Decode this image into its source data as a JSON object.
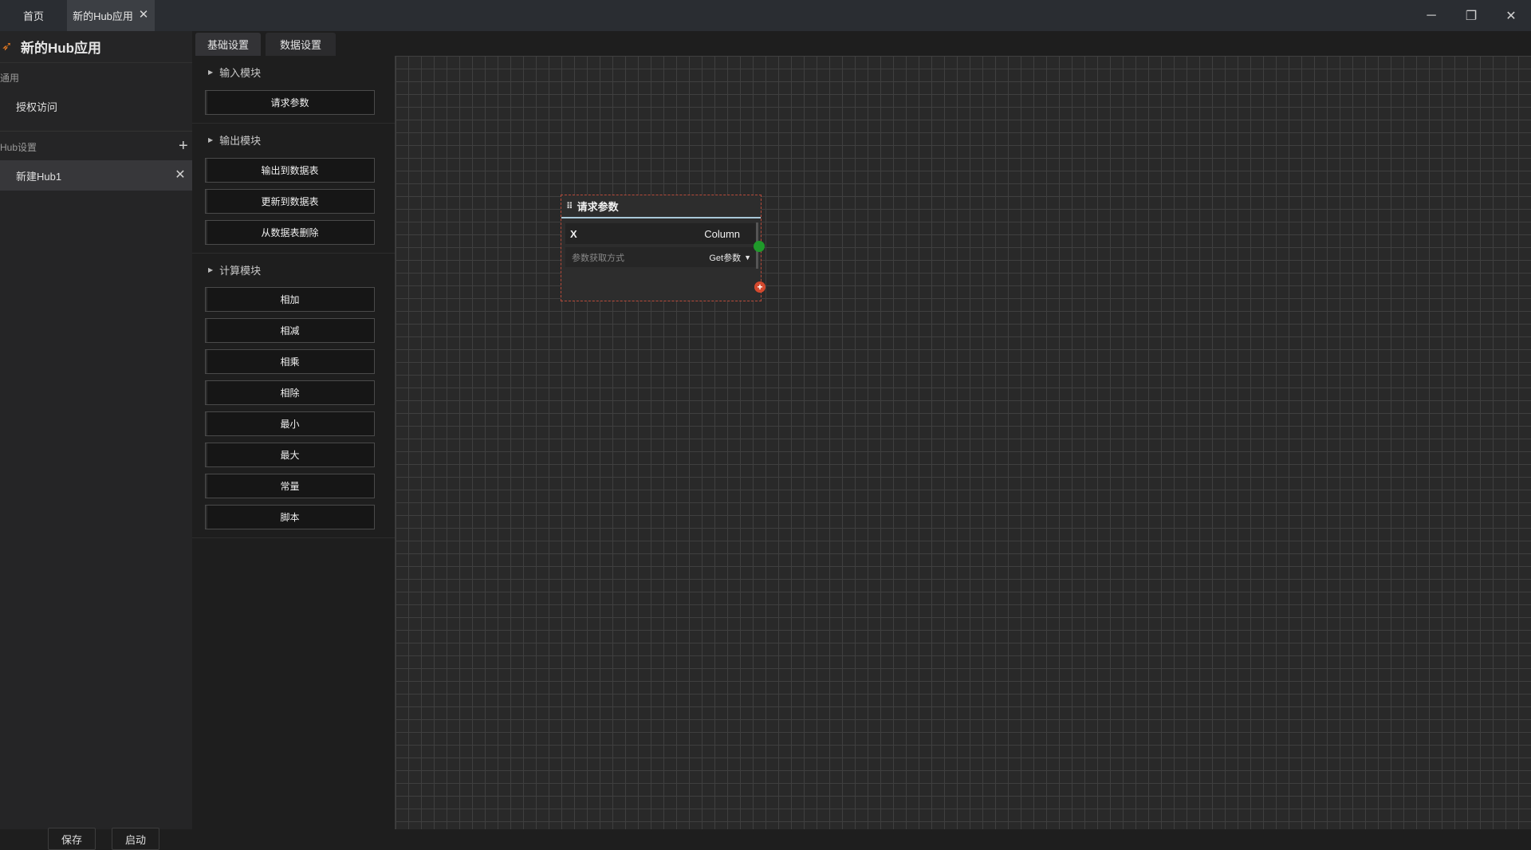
{
  "titlebar": {
    "tabs": [
      {
        "label": "首页"
      },
      {
        "label": "新的Hub应用"
      }
    ],
    "controls": {
      "minimize": "─",
      "maximize": "❐",
      "close": "✕"
    }
  },
  "sidebar": {
    "app_title": "新的Hub应用",
    "general_section": "通用",
    "general_items": [
      {
        "label": "授权访问"
      }
    ],
    "hub_section": "Hub设置",
    "hub_items": [
      {
        "label": "新建Hub1"
      }
    ],
    "save_label": "保存",
    "start_label": "启动"
  },
  "module_panel": {
    "tabs": [
      {
        "label": "基础设置"
      },
      {
        "label": "数据设置"
      }
    ],
    "groups": [
      {
        "title": "输入模块",
        "modules": [
          "请求参数"
        ]
      },
      {
        "title": "输出模块",
        "modules": [
          "输出到数据表",
          "更新到数据表",
          "从数据表删除"
        ]
      },
      {
        "title": "计算模块",
        "modules": [
          "相加",
          "相减",
          "相乘",
          "相除",
          "最小",
          "最大",
          "常量",
          "脚本"
        ]
      }
    ]
  },
  "node": {
    "title": "请求参数",
    "field_name": "X",
    "field_type": "Column",
    "param_placeholder": "参数获取方式",
    "param_method": "Get参数"
  },
  "colors": {
    "accent_orange": "#e77b22",
    "port_green": "#1f9a2a",
    "add_red": "#d4492e",
    "node_border": "#b84a3a"
  },
  "icons": {
    "app_logo": "rocket-icon",
    "add_hub": "plus-icon",
    "drag": "drag-handle-icon",
    "chevron": "chevron-down-icon"
  }
}
